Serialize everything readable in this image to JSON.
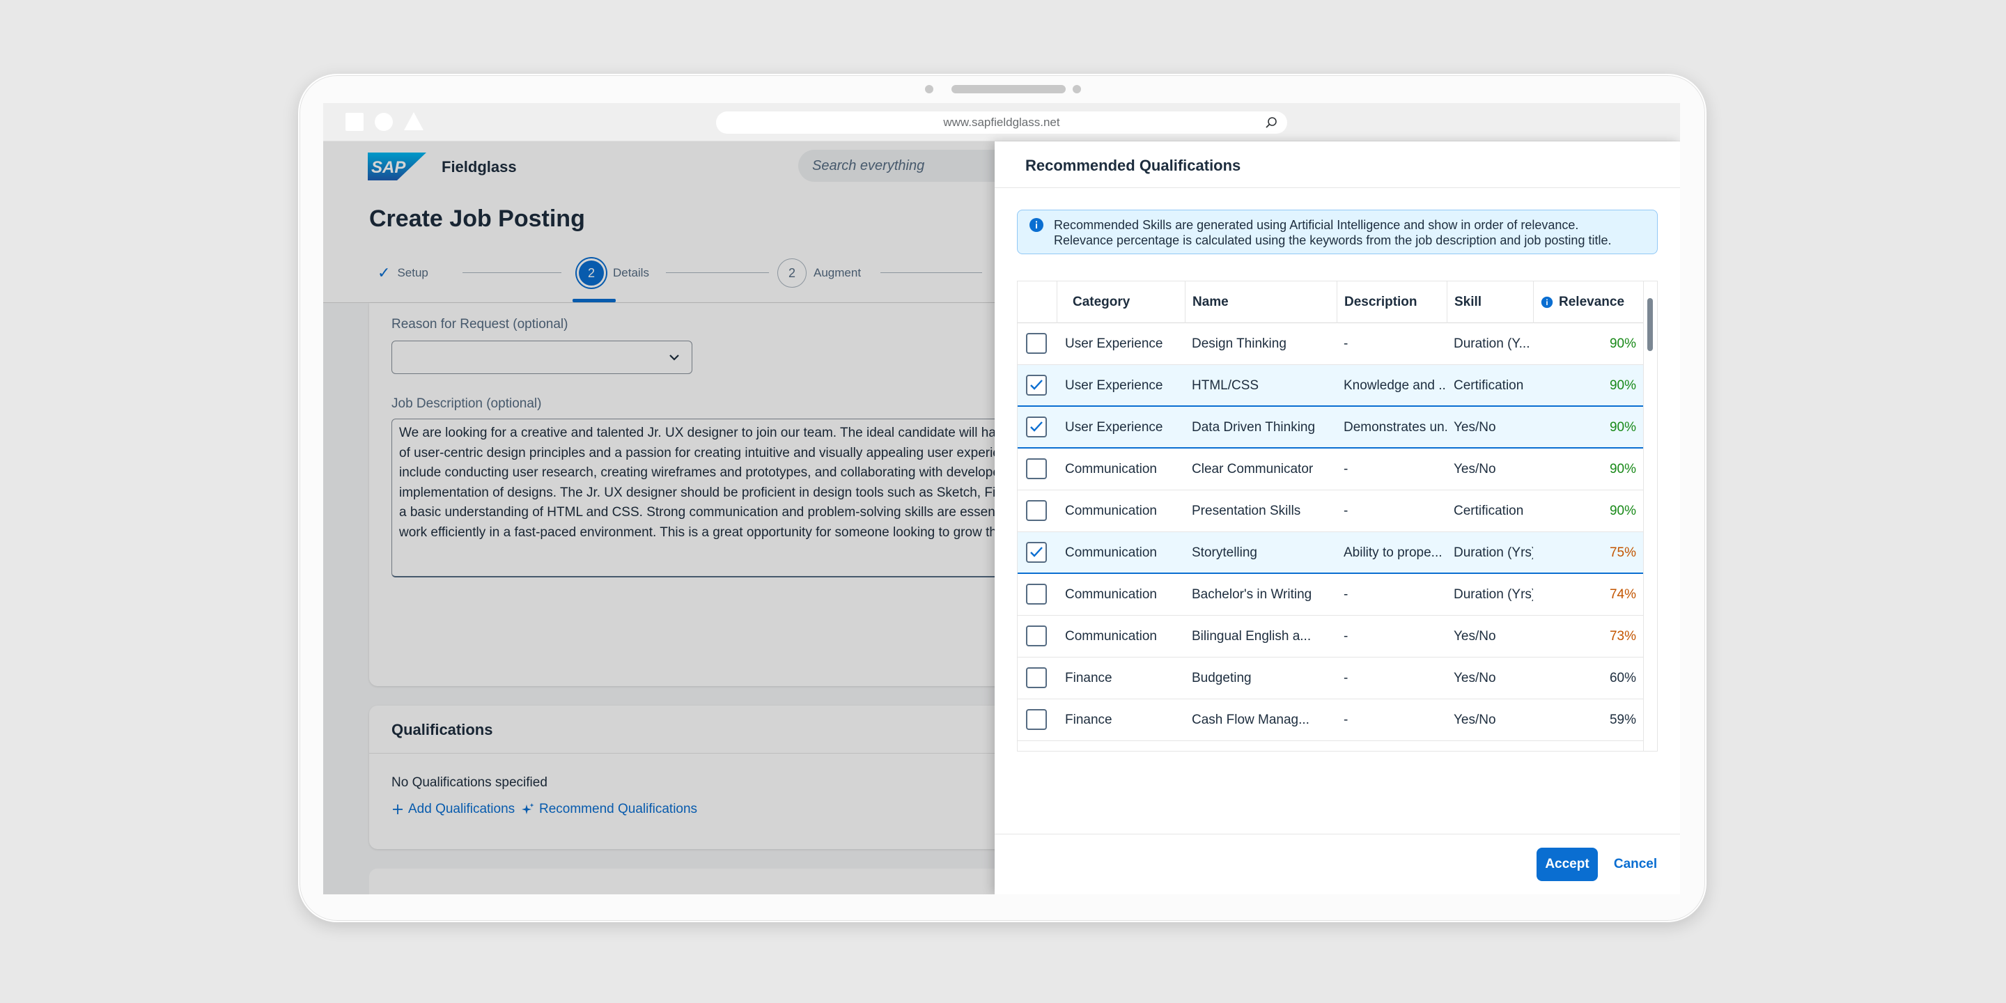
{
  "browser": {
    "url": "www.sapfieldglass.net"
  },
  "shell": {
    "app_name": "Fieldglass",
    "search_placeholder": "Search everything",
    "logo_text": "SAP"
  },
  "page": {
    "title": "Create Job Posting",
    "steps": [
      {
        "label": "Setup",
        "marker": "✓"
      },
      {
        "label": "Details",
        "marker": "2"
      },
      {
        "label": "Augment",
        "marker": "2"
      }
    ]
  },
  "form": {
    "reason_label": "Reason for Request (optional)",
    "reason_value": "",
    "job_desc_label": "Job Description (optional)",
    "job_desc_lines": [
      "We are looking for a creative and talented Jr. UX designer to join our team. The ideal candidate will hav",
      "of user-centric design principles and a passion for creating intuitive and visually appealing user experie",
      "include conducting user research, creating wireframes and prototypes, and collaborating with develope",
      "implementation of designs. The Jr. UX designer should be proficient in design tools such as Sketch, Fig",
      "a basic understanding of HTML and CSS. Strong communication and problem-solving skills are essenti",
      "work efficiently in a fast-paced environment. This is a great opportunity for someone looking to grow th"
    ]
  },
  "qualifications_card": {
    "title": "Qualifications",
    "empty_text": "No Qualifications specified",
    "add_link": "Add Qualifications",
    "recommend_link": "Recommend Qualifications"
  },
  "dialog": {
    "title": "Recommended Qualifications",
    "info_line1": "Recommended Skills are generated using Artificial Intelligence and show in order of relevance.",
    "info_line2": "Relevance percentage is calculated using the keywords from the job description and job posting title.",
    "columns": [
      "Category",
      "Name",
      "Description",
      "Skill",
      "Relevance"
    ],
    "rows": [
      {
        "checked": false,
        "category": "User Experience",
        "name": "Design Thinking",
        "description": "-",
        "skill": "Duration (Y...",
        "relevance": "90%",
        "level": "high"
      },
      {
        "checked": true,
        "category": "User Experience",
        "name": "HTML/CSS",
        "description": "Knowledge and ...",
        "skill": "Certification",
        "relevance": "90%",
        "level": "high"
      },
      {
        "checked": true,
        "category": "User Experience",
        "name": "Data Driven Thinking",
        "description": "Demonstrates un..",
        "skill": "Yes/No",
        "relevance": "90%",
        "level": "high"
      },
      {
        "checked": false,
        "category": "Communication",
        "name": "Clear Communicator",
        "description": "-",
        "skill": "Yes/No",
        "relevance": "90%",
        "level": "high"
      },
      {
        "checked": false,
        "category": "Communication",
        "name": "Presentation Skills",
        "description": "-",
        "skill": "Certification",
        "relevance": "90%",
        "level": "high"
      },
      {
        "checked": true,
        "category": "Communication",
        "name": "Storytelling",
        "description": "Ability to prope...",
        "skill": "Duration (Yrs)",
        "relevance": "75%",
        "level": "medium"
      },
      {
        "checked": false,
        "category": "Communication",
        "name": "Bachelor's in Writing",
        "description": "-",
        "skill": "Duration (Yrs)",
        "relevance": "74%",
        "level": "medium"
      },
      {
        "checked": false,
        "category": "Communication",
        "name": "Bilingual English a...",
        "description": "-",
        "skill": "Yes/No",
        "relevance": "73%",
        "level": "medium"
      },
      {
        "checked": false,
        "category": "Finance",
        "name": "Budgeting",
        "description": "-",
        "skill": "Yes/No",
        "relevance": "60%",
        "level": "low"
      },
      {
        "checked": false,
        "category": "Finance",
        "name": "Cash Flow Manag...",
        "description": "-",
        "skill": "Yes/No",
        "relevance": "59%",
        "level": "low"
      }
    ],
    "accept_label": "Accept",
    "cancel_label": "Cancel"
  },
  "colors": {
    "accent": "#0a6ed1",
    "relevance_high": "#188918",
    "relevance_medium": "#c35500",
    "relevance_low": "#1d2d3e"
  }
}
